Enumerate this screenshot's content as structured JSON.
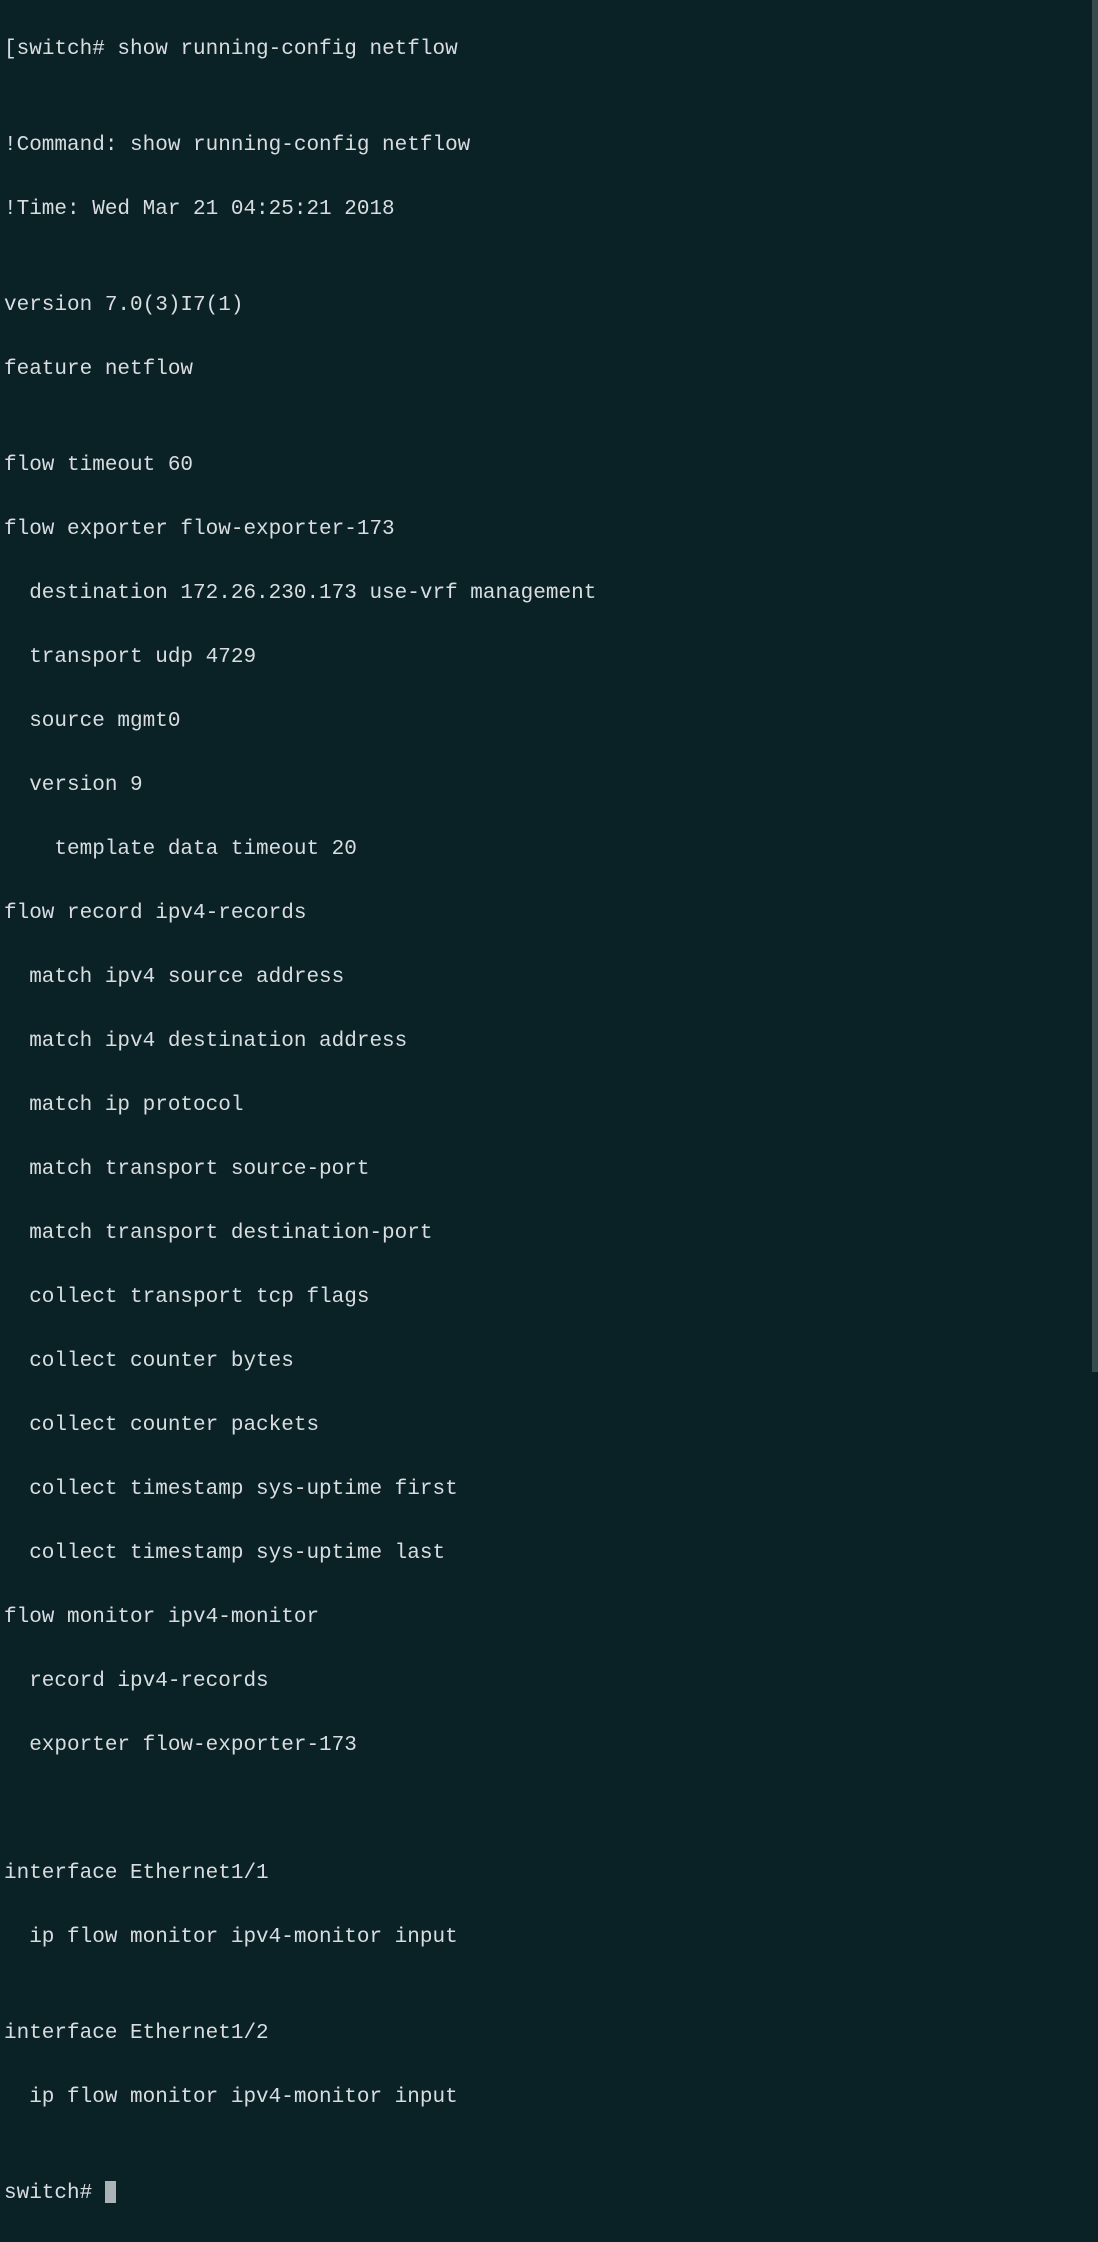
{
  "prompt1_bracket": "[",
  "prompt1_host": "switch#",
  "prompt1_command": " show running-config netflow",
  "output": {
    "blank1": "",
    "comment1": "!Command: show running-config netflow",
    "comment2": "!Time: Wed Mar 21 04:25:21 2018",
    "blank2": "",
    "version": "version 7.0(3)I7(1)",
    "feature": "feature netflow",
    "blank3": "",
    "flow_timeout": "flow timeout 60",
    "flow_exporter": "flow exporter flow-exporter-173",
    "exp_dest": "  destination 172.26.230.173 use-vrf management",
    "exp_transport": "  transport udp 4729",
    "exp_source": "  source mgmt0",
    "exp_version": "  version 9",
    "exp_template": "    template data timeout 20",
    "flow_record": "flow record ipv4-records",
    "rec_match1": "  match ipv4 source address",
    "rec_match2": "  match ipv4 destination address",
    "rec_match3": "  match ip protocol",
    "rec_match4": "  match transport source-port",
    "rec_match5": "  match transport destination-port",
    "rec_collect1": "  collect transport tcp flags",
    "rec_collect2": "  collect counter bytes",
    "rec_collect3": "  collect counter packets",
    "rec_collect4": "  collect timestamp sys-uptime first",
    "rec_collect5": "  collect timestamp sys-uptime last",
    "flow_monitor": "flow monitor ipv4-monitor",
    "mon_record": "  record ipv4-records",
    "mon_exporter": "  exporter flow-exporter-173",
    "blank4": "",
    "blank5": "",
    "iface1": "interface Ethernet1/1",
    "iface1_cfg": "  ip flow monitor ipv4-monitor input",
    "blank6": "",
    "iface2": "interface Ethernet1/2",
    "iface2_cfg": "  ip flow monitor ipv4-monitor input",
    "blank7": ""
  },
  "prompt2_host": "switch# "
}
